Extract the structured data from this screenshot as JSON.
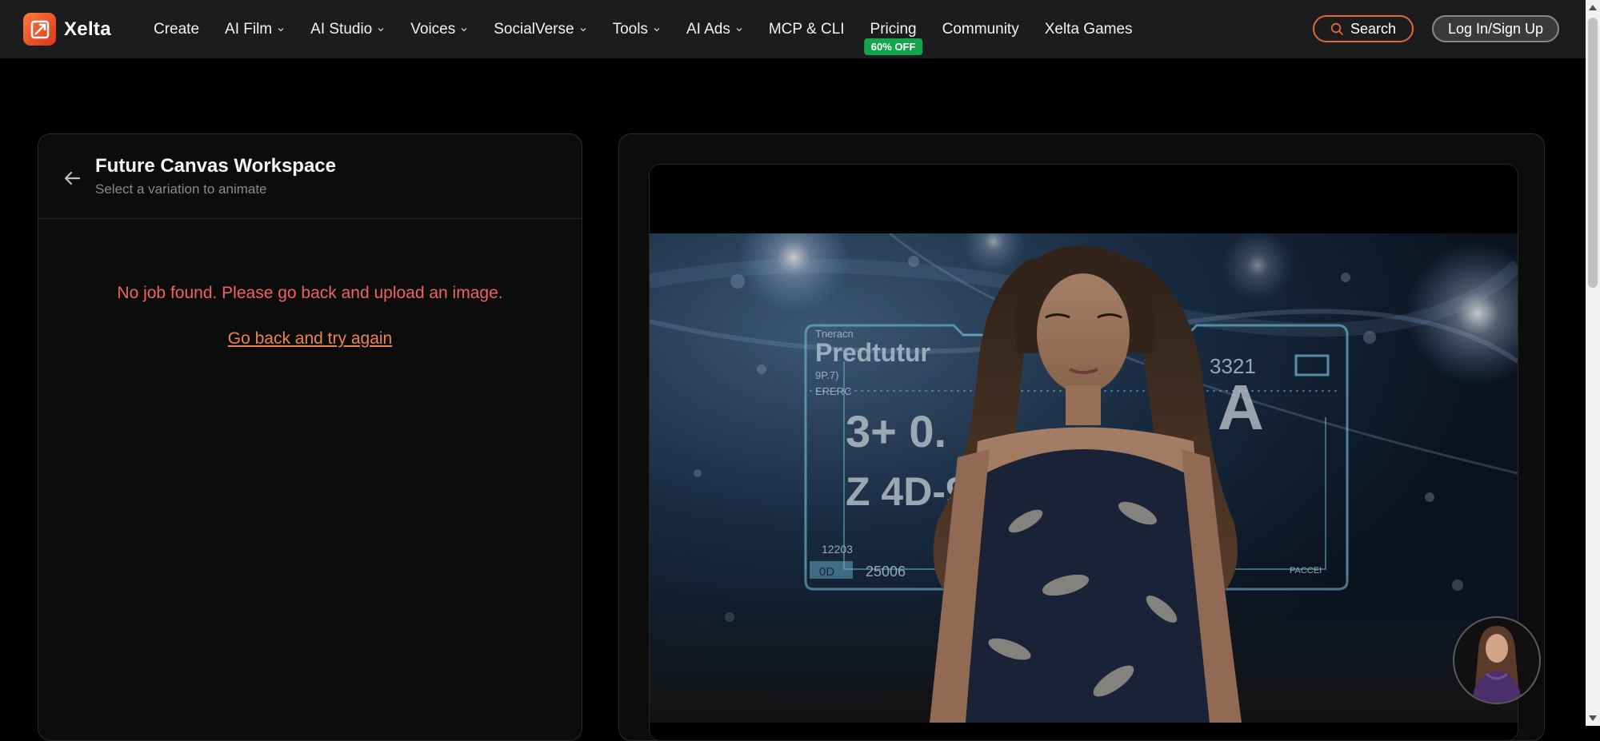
{
  "brand": {
    "name": "Xelta"
  },
  "nav": {
    "items": [
      {
        "label": "Create",
        "dropdown": false
      },
      {
        "label": "AI Film",
        "dropdown": true
      },
      {
        "label": "AI Studio",
        "dropdown": true
      },
      {
        "label": "Voices",
        "dropdown": true
      },
      {
        "label": "SocialVerse",
        "dropdown": true
      },
      {
        "label": "Tools",
        "dropdown": true
      },
      {
        "label": "AI Ads",
        "dropdown": true
      },
      {
        "label": "MCP & CLI",
        "dropdown": false
      },
      {
        "label": "Pricing",
        "dropdown": false
      },
      {
        "label": "Community",
        "dropdown": false
      },
      {
        "label": "Xelta Games",
        "dropdown": false
      }
    ],
    "pricing_badge": "60% OFF",
    "search_label": "Search",
    "login_label": "Log In/Sign Up"
  },
  "workspace": {
    "title": "Future Canvas Workspace",
    "subtitle": "Select a variation to animate",
    "error_message": "No job found. Please go back and upload an image.",
    "retry_link": "Go back and try again"
  },
  "preview": {
    "hud_text": {
      "top_small": "Tneracn",
      "headline": "Predtutur",
      "line_a": "9P.7)",
      "line_b": "ERERC",
      "big_a": "3+ 0.",
      "big_b": "Z 4D-9-",
      "code": "3321",
      "letter": "A",
      "bottom_a": "12203",
      "bottom_b": "0D",
      "bottom_c": "25006",
      "bottom_d": "PACCEI"
    }
  },
  "colors": {
    "accent": "#e2673a",
    "error": "#f06262",
    "link": "#f0824e",
    "badge": "#12a54a",
    "nav_bg": "#1c1c1e"
  },
  "icons": [
    "xelta-logo-icon",
    "chevron-down-icon",
    "search-icon",
    "back-arrow-icon",
    "assistant-avatar-icon"
  ]
}
